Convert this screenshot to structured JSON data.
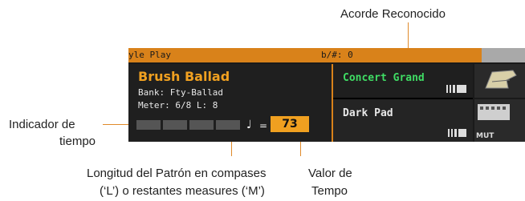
{
  "callouts": {
    "chord": "Acorde Reconocido",
    "beat_line1": "Indicador de",
    "beat_line2": "tiempo",
    "length_line1": "Longitud del Patrón en compases",
    "length_line2": "(‘L’) o restantes measures (‘M’)",
    "tempo_line1": "Valor de",
    "tempo_line2": "Tempo"
  },
  "title_bar": {
    "app": "yle Play",
    "accidental": "b/#: 0"
  },
  "style": {
    "name": "Brush Ballad",
    "bank": "Bank: Fty-Ballad",
    "meter": "Meter: 6/8 L:  8",
    "tempo_eq": "=",
    "tempo_value": "73"
  },
  "sounds": [
    {
      "name": "Concert Grand"
    },
    {
      "name": "Dark Pad"
    }
  ],
  "mute_label": "MUT",
  "colors": {
    "accent": "#d9821a",
    "tempo_bg": "#f0a020",
    "upper1": "#3fdc64"
  }
}
